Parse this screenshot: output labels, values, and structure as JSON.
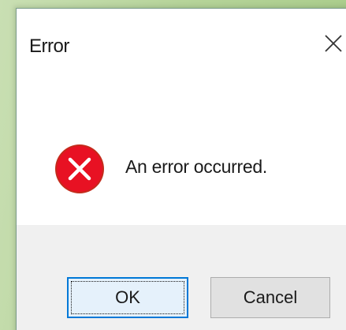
{
  "dialog": {
    "title": "Error",
    "close_icon": "close-icon",
    "message": "An error occurred.",
    "status_icon": "error-icon",
    "buttons": {
      "ok_label": "OK",
      "cancel_label": "Cancel"
    }
  },
  "colors": {
    "error_red": "#e81123",
    "focus_blue": "#0078d7",
    "footer_bg": "#f0f0f0",
    "background_green": "#b6d49a"
  }
}
